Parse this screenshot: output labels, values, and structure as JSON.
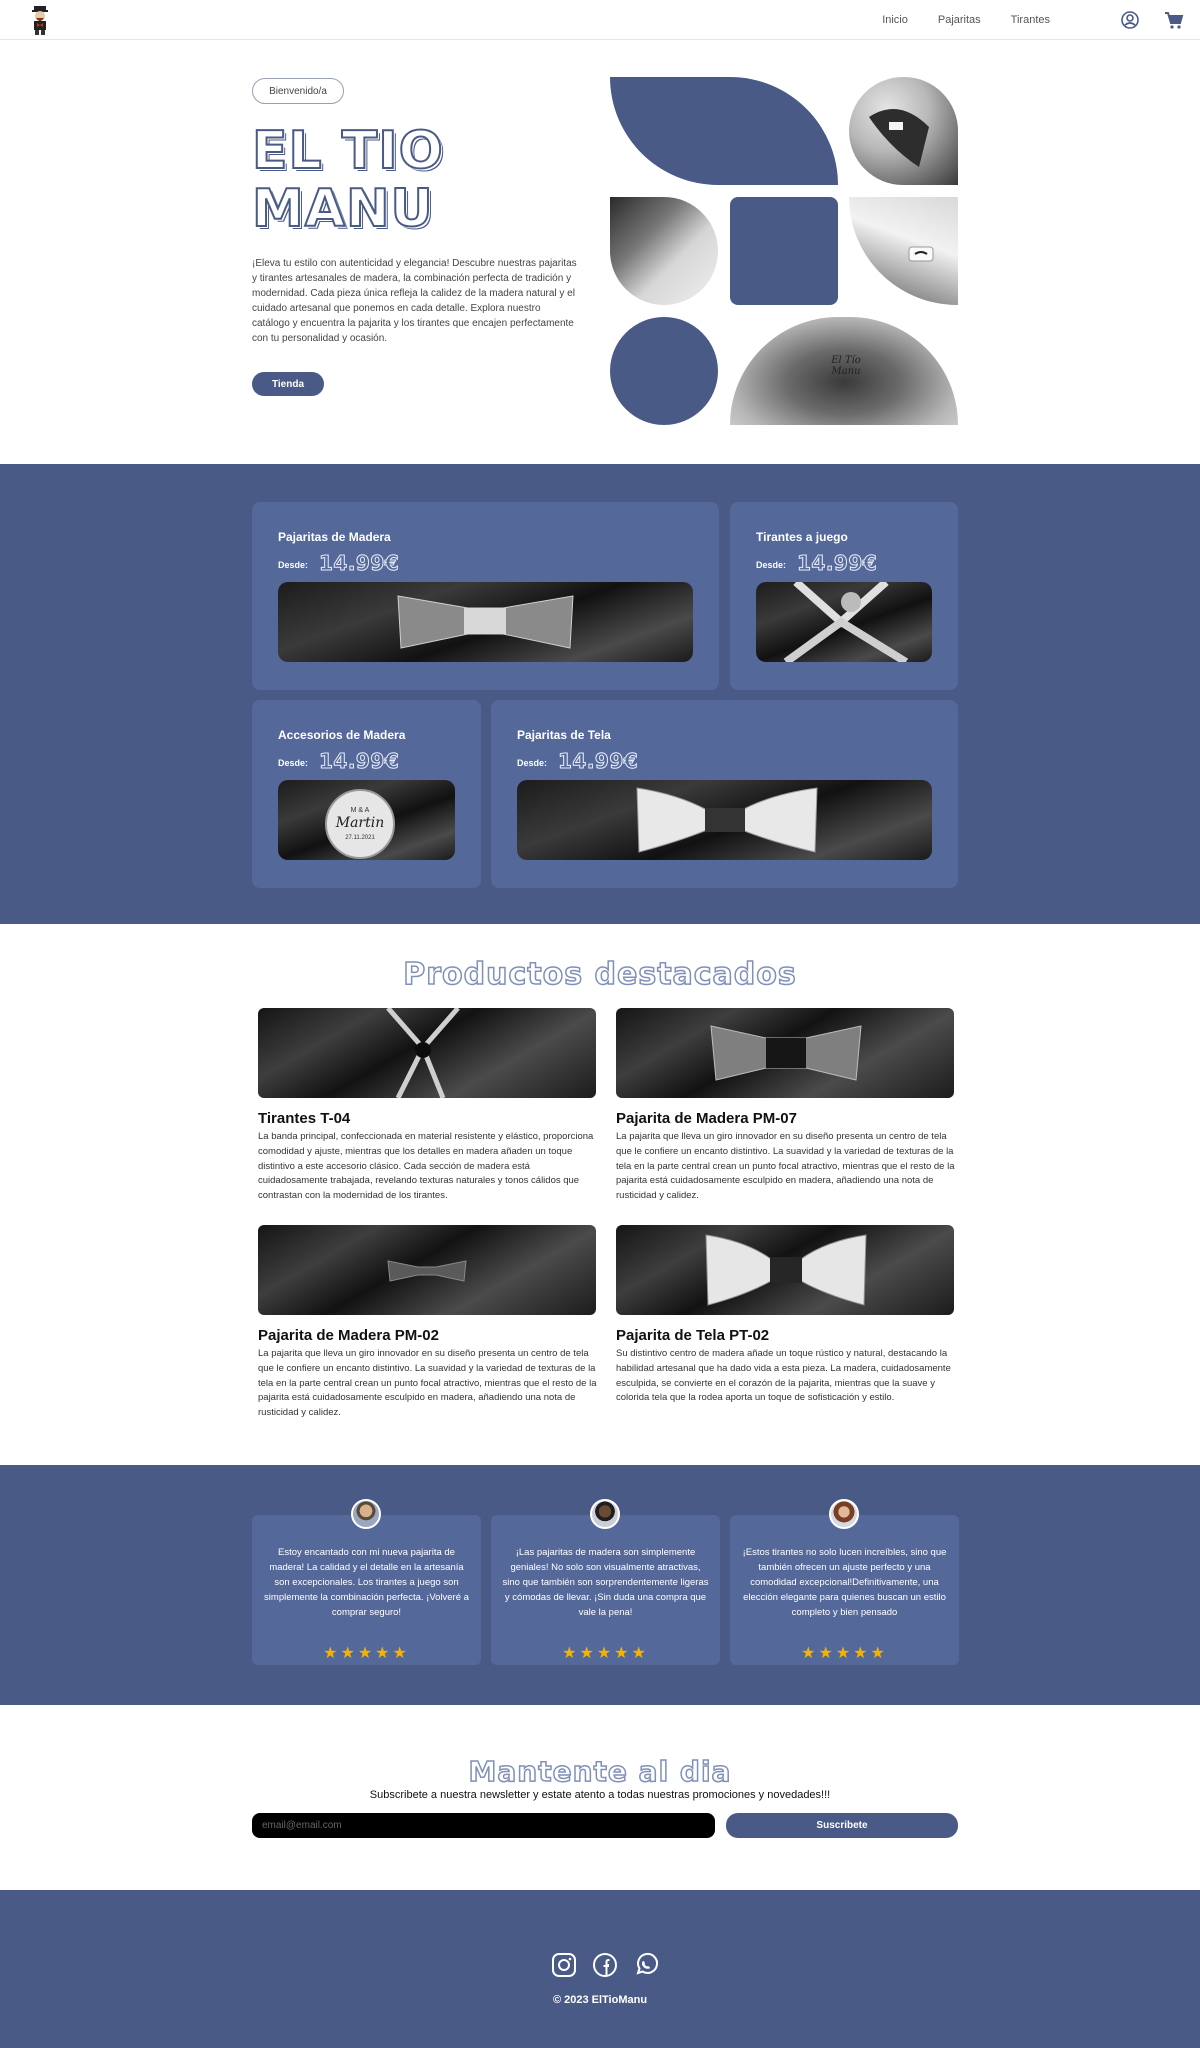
{
  "nav": {
    "links": [
      "Inicio",
      "Pajaritas",
      "Tirantes"
    ],
    "icons": [
      "user-icon",
      "cart-icon"
    ]
  },
  "hero": {
    "badge": "Bienvenido/a",
    "title_line1": "EL TIO",
    "title_line2": "MANU",
    "description": "¡Eleva tu estilo con autenticidad y elegancia! Descubre nuestras pajaritas y tirantes artesanales de madera, la combinación perfecta de tradición y modernidad. Cada pieza única refleja la calidez de la madera natural y el cuidado artesanal que ponemos en cada detalle. Explora nuestro catálogo y encuentra la pajarita y los tirantes que encajen perfectamente con tu personalidad y ocasión.",
    "button": "Tienda",
    "accent_color": "#4a5a87",
    "image_text": "El Tío Manu"
  },
  "categories": [
    {
      "title": "Pajaritas de Madera",
      "from_label": "Desde:",
      "price": "14.99€"
    },
    {
      "title": "Tirantes a juego",
      "from_label": "Desde:",
      "price": "14.99€"
    },
    {
      "title": "Accesorios de Madera",
      "from_label": "Desde:",
      "price": "14.99€",
      "image_text": [
        "M & A",
        "Martin",
        "27.11.2021"
      ]
    },
    {
      "title": "Pajaritas de Tela",
      "from_label": "Desde:",
      "price": "14.99€"
    }
  ],
  "featured": {
    "title": "Productos destacados",
    "products": [
      {
        "title": "Tirantes T-04",
        "description": "La banda principal, confeccionada en material resistente y elástico, proporciona comodidad y ajuste, mientras que los detalles en madera añaden un toque distintivo a este accesorio clásico. Cada sección de madera está cuidadosamente trabajada, revelando texturas naturales y tonos cálidos que contrastan con la modernidad de los tirantes."
      },
      {
        "title": "Pajarita de Madera PM-07",
        "description": "La pajarita que lleva un giro innovador en su diseño presenta un centro de tela que le confiere un encanto distintivo. La suavidad y la variedad de texturas de la tela en la parte central crean un punto focal atractivo, mientras que el resto de la pajarita está cuidadosamente esculpido en madera, añadiendo una nota de rusticidad y calidez."
      },
      {
        "title": "Pajarita de Madera PM-02",
        "description": "La pajarita que lleva un giro innovador en su diseño presenta un centro de tela que le confiere un encanto distintivo. La suavidad y la variedad de texturas de la tela en la parte central crean un punto focal atractivo, mientras que el resto de la pajarita está cuidadosamente esculpido en madera, añadiendo una nota de rusticidad y calidez."
      },
      {
        "title": "Pajarita de Tela PT-02",
        "description": "Su distintivo centro de madera añade un toque rústico y natural, destacando la habilidad artesanal que ha dado vida a esta pieza. La madera, cuidadosamente esculpida, se convierte en el corazón de la pajarita, mientras que la suave y colorida tela que la rodea aporta un toque de sofisticación y estilo."
      }
    ]
  },
  "testimonials": [
    {
      "text": "Estoy encantado con mi nueva pajarita de madera! La calidad y el detalle en la artesanía son excepcionales. Los tirantes a juego son simplemente la combinación perfecta. ¡Volveré a comprar seguro!",
      "stars": 5
    },
    {
      "text": "¡Las pajaritas de madera son simplemente geniales! No solo son visualmente atractivas, sino que también son sorprendentemente ligeras y cómodas de llevar. ¡Sin duda una compra que vale la pena!",
      "stars": 5
    },
    {
      "text": "¡Estos tirantes no solo lucen increíbles, sino que también ofrecen un ajuste perfecto y una comodidad excepcional!Definitivamente, una elección elegante para quienes buscan un estilo completo y bien pensado",
      "stars": 5
    }
  ],
  "newsletter": {
    "title": "Mantente al dia",
    "subtitle": "Subscribete a nuestra newsletter y estate atento a todas nuestras promociones y novedades!!!",
    "placeholder": "email@email.com",
    "button": "Suscribete"
  },
  "footer": {
    "icons": [
      "instagram-icon",
      "facebook-icon",
      "whatsapp-icon"
    ],
    "copyright": "© 2023 ElTioManu"
  }
}
